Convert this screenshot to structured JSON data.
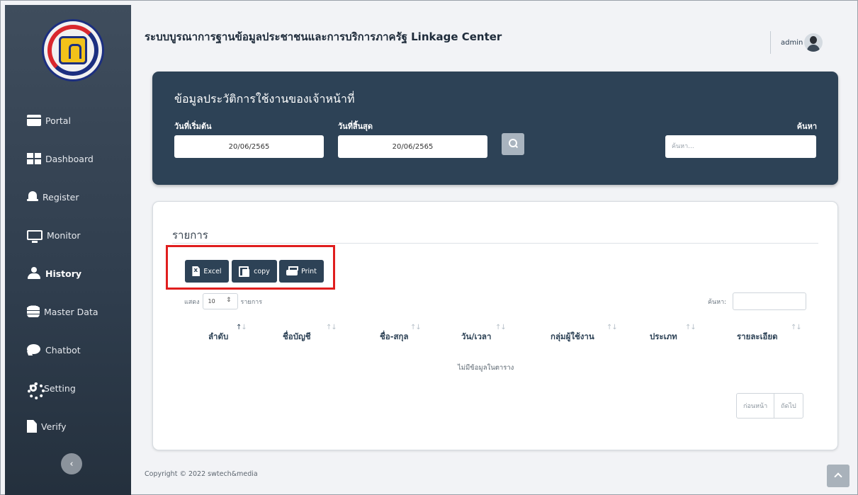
{
  "header": {
    "title": "ระบบบูรณาการฐานข้อมูลประชาชนและการบริการภาครัฐ Linkage Center",
    "user": "admin"
  },
  "sidebar": {
    "items": [
      {
        "label": "Portal",
        "icon": "portal-icon"
      },
      {
        "label": "Dashboard",
        "icon": "dashboard-icon"
      },
      {
        "label": "Register",
        "icon": "bell-icon"
      },
      {
        "label": "Monitor",
        "icon": "monitor-icon"
      },
      {
        "label": "History",
        "icon": "user-icon",
        "active": true
      },
      {
        "label": "Master Data",
        "icon": "database-icon"
      },
      {
        "label": "Chatbot",
        "icon": "chat-icon"
      },
      {
        "label": "Setting",
        "icon": "gear-icon"
      },
      {
        "label": "Verify",
        "icon": "file-icon"
      }
    ]
  },
  "filter": {
    "title": "ข้อมูลประวัติการใช้งานของเจ้าหน้าที่",
    "start_label": "วันที่เริ่มต้น",
    "start_value": "20/06/2565",
    "end_label": "วันที่สิ้นสุด",
    "end_value": "20/06/2565",
    "keyword_label": "ค้นหา",
    "keyword_placeholder": "ค้นหา..."
  },
  "list": {
    "title": "รายการ",
    "buttons": {
      "excel": "Excel",
      "copy": "copy",
      "print": "Print"
    },
    "length_prefix": "แสดง",
    "length_value": "10",
    "length_suffix": "รายการ",
    "search_label": "ค้นหา:",
    "columns": [
      "ลำดับ",
      "ชื่อบัญชี",
      "ชื่อ-สกุล",
      "วัน/เวลา",
      "กลุ่มผู้ใช้งาน",
      "ประเภท",
      "รายละเอียด"
    ],
    "empty_message": "ไม่มีข้อมูลในตาราง",
    "pager": {
      "prev": "ก่อนหน้า",
      "next": "ถัดไป"
    }
  },
  "footer": {
    "copyright": "Copyright © 2022 swtech&media"
  },
  "colors": {
    "sidebar": "#34424f",
    "accent": "#2d4256",
    "highlight": "#e01e1e"
  }
}
